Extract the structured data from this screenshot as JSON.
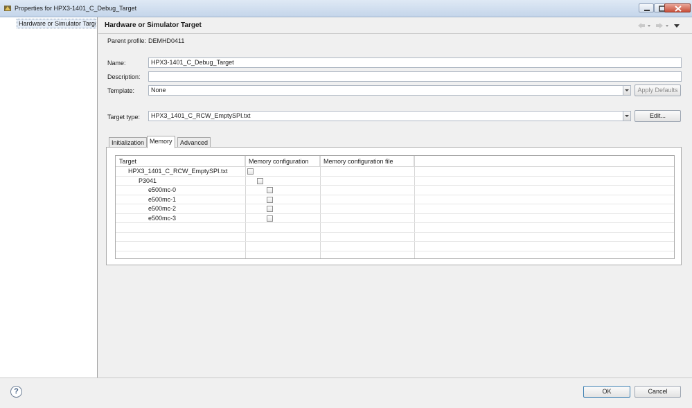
{
  "window": {
    "title": "Properties for HPX3-1401_C_Debug_Target"
  },
  "sidebar": {
    "items": [
      {
        "label": "Hardware or Simulator Target"
      }
    ]
  },
  "page": {
    "title": "Hardware or Simulator Target",
    "parent_profile_label": "Parent profile:",
    "parent_profile_value": "DEMHD0411"
  },
  "form": {
    "name_label": "Name:",
    "name_value": "HPX3-1401_C_Debug_Target",
    "description_label": "Description:",
    "description_value": "",
    "template_label": "Template:",
    "template_value": "None",
    "apply_defaults_label": "Apply Defaults",
    "target_type_label": "Target type:",
    "target_type_value": "HPX3_1401_C_RCW_EmptySPI.txt",
    "edit_label": "Edit..."
  },
  "tabs": [
    {
      "label": "Initialization"
    },
    {
      "label": "Memory"
    },
    {
      "label": "Advanced"
    }
  ],
  "memory_table": {
    "columns": [
      "Target",
      "Memory configuration",
      "Memory configuration file"
    ],
    "rows": [
      {
        "target": "HPX3_1401_C_RCW_EmptySPI.txt",
        "checked": false
      },
      {
        "target": "P3041",
        "checked": false
      },
      {
        "target": "e500mc-0",
        "checked": false
      },
      {
        "target": "e500mc-1",
        "checked": false
      },
      {
        "target": "e500mc-2",
        "checked": false
      },
      {
        "target": "e500mc-3",
        "checked": false
      }
    ]
  },
  "footer": {
    "ok_label": "OK",
    "cancel_label": "Cancel",
    "help_icon": "help-icon"
  },
  "colors": {
    "selection": "#e6eef8",
    "titlebar": "#c4d5ea"
  }
}
